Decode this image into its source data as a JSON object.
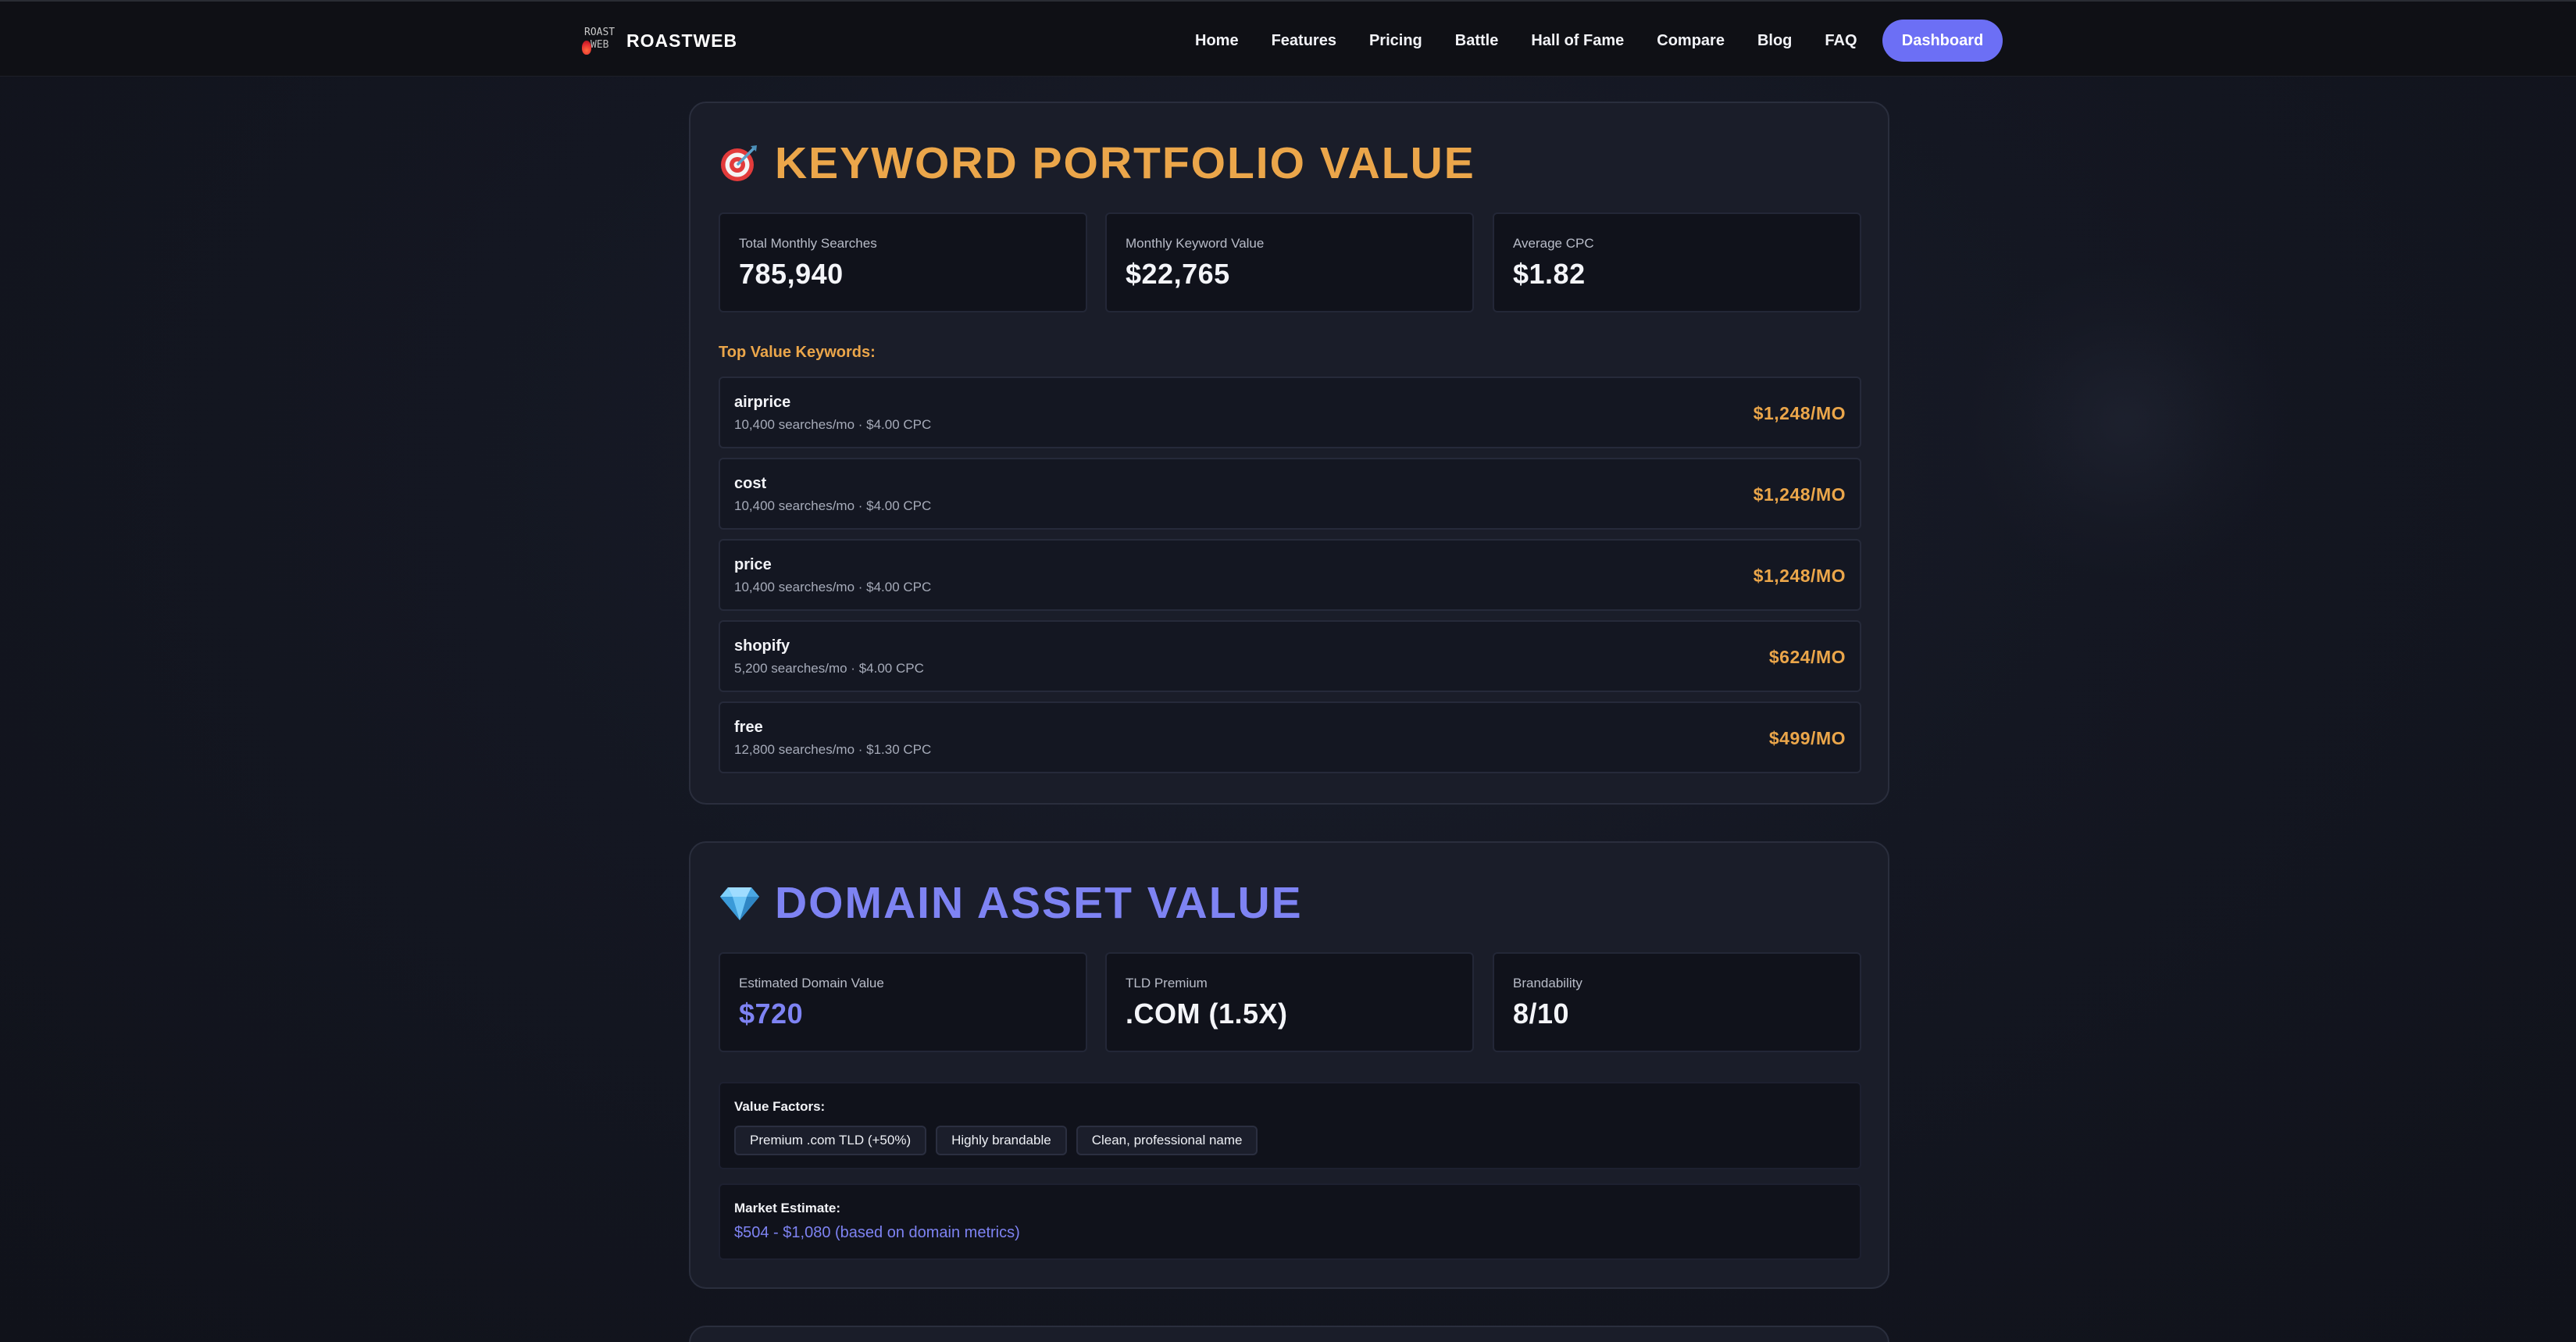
{
  "nav": {
    "brand": "ROASTWEB",
    "logo_text_top": "ROAST",
    "logo_text_bottom": "WEB",
    "links": [
      "Home",
      "Features",
      "Pricing",
      "Battle",
      "Hall of Fame",
      "Compare",
      "Blog",
      "FAQ"
    ],
    "dashboard_label": "Dashboard"
  },
  "keyword_portfolio": {
    "icon": "target-icon",
    "title": "KEYWORD PORTFOLIO VALUE",
    "stats": [
      {
        "label": "Total Monthly Searches",
        "value": "785,940"
      },
      {
        "label": "Monthly Keyword Value",
        "value": "$22,765"
      },
      {
        "label": "Average CPC",
        "value": "$1.82"
      }
    ],
    "top_label": "Top Value Keywords:",
    "keywords": [
      {
        "name": "airprice",
        "meta": "10,400 searches/mo · $4.00 CPC",
        "amount": "$1,248/MO"
      },
      {
        "name": "cost",
        "meta": "10,400 searches/mo · $4.00 CPC",
        "amount": "$1,248/MO"
      },
      {
        "name": "price",
        "meta": "10,400 searches/mo · $4.00 CPC",
        "amount": "$1,248/MO"
      },
      {
        "name": "shopify",
        "meta": "5,200 searches/mo · $4.00 CPC",
        "amount": "$624/MO"
      },
      {
        "name": "free",
        "meta": "12,800 searches/mo · $1.30 CPC",
        "amount": "$499/MO"
      }
    ]
  },
  "domain_asset": {
    "icon": "gem-icon",
    "title": "DOMAIN ASSET VALUE",
    "stats": [
      {
        "label": "Estimated Domain Value",
        "value": "$720"
      },
      {
        "label": "TLD Premium",
        "value": ".COM (1.5X)"
      },
      {
        "label": "Brandability",
        "value": "8/10"
      }
    ],
    "factors_label": "Value Factors:",
    "factors": [
      "Premium .com TLD (+50%)",
      "Highly brandable",
      "Clean, professional name"
    ],
    "market_label": "Market Estimate:",
    "market_value": "$504 - $1,080 (based on domain metrics)"
  },
  "colors": {
    "accent_orange": "#eba64a",
    "accent_purple": "#7e83f3",
    "button": "#6c6ff5",
    "background": "#141722"
  }
}
